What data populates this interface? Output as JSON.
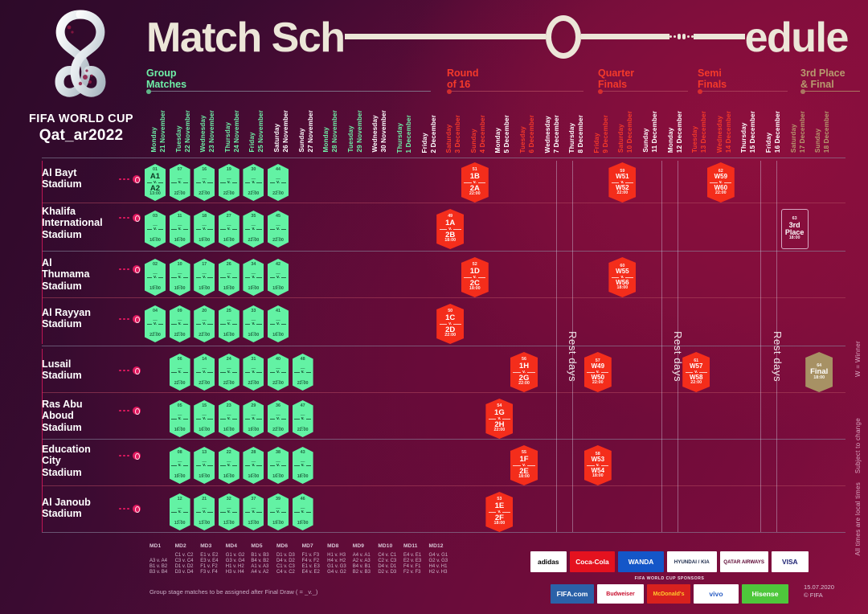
{
  "header": {
    "title_part1": "Match Sch",
    "title_part2": "edule",
    "brand_line1": "FIFA WORLD CUP",
    "brand_line2": "Qat_ar2022",
    "trophy_alt": "qatar-2022-emblem"
  },
  "phases": [
    {
      "label": "Group\nMatches",
      "color": "#6ef0a7"
    },
    {
      "label": "Round\nof 16",
      "color": "#f4392a"
    },
    {
      "label": "Quarter\nFinals",
      "color": "#f4392a"
    },
    {
      "label": "Semi\nFinals",
      "color": "#f4392a"
    },
    {
      "label": "3rd Place\n& Final",
      "color": "#b79a6e"
    }
  ],
  "dates": [
    {
      "day": "Monday",
      "date": "21 November",
      "color": "#6ef0a7"
    },
    {
      "day": "Tuesday",
      "date": "22 November",
      "color": "#6ef0a7"
    },
    {
      "day": "Wednesday",
      "date": "23 November",
      "color": "#6ef0a7"
    },
    {
      "day": "Thursday",
      "date": "24 November",
      "color": "#6ef0a7"
    },
    {
      "day": "Friday",
      "date": "25 November",
      "color": "#6ef0a7"
    },
    {
      "day": "Saturday",
      "date": "26 November",
      "color": "#ffffff"
    },
    {
      "day": "Sunday",
      "date": "27 November",
      "color": "#ffffff"
    },
    {
      "day": "Monday",
      "date": "28 November",
      "color": "#6ef0a7"
    },
    {
      "day": "Tuesday",
      "date": "29 November",
      "color": "#6ef0a7"
    },
    {
      "day": "Wednesday",
      "date": "30 November",
      "color": "#ffffff"
    },
    {
      "day": "Thursday",
      "date": "1 December",
      "color": "#6ef0a7"
    },
    {
      "day": "Friday",
      "date": "2 December",
      "color": "#ffffff"
    },
    {
      "day": "Saturday",
      "date": "3 December",
      "color": "#f4392a"
    },
    {
      "day": "Sunday",
      "date": "4 December",
      "color": "#f4392a"
    },
    {
      "day": "Monday",
      "date": "5 December",
      "color": "#ffffff"
    },
    {
      "day": "Tuesday",
      "date": "6 December",
      "color": "#f4392a"
    },
    {
      "day": "Wednesday",
      "date": "7 December",
      "color": "#ffffff"
    },
    {
      "day": "Thursday",
      "date": "8 December",
      "color": "#ffffff"
    },
    {
      "day": "Friday",
      "date": "9 December",
      "color": "#f4392a"
    },
    {
      "day": "Saturday",
      "date": "10 December",
      "color": "#f4392a"
    },
    {
      "day": "Sunday",
      "date": "11 December",
      "color": "#ffffff"
    },
    {
      "day": "Monday",
      "date": "12 December",
      "color": "#ffffff"
    },
    {
      "day": "Tuesday",
      "date": "13 December",
      "color": "#f4392a"
    },
    {
      "day": "Wednesday",
      "date": "14 December",
      "color": "#f4392a"
    },
    {
      "day": "Thursday",
      "date": "15 December",
      "color": "#ffffff"
    },
    {
      "day": "Friday",
      "date": "16 December",
      "color": "#ffffff"
    },
    {
      "day": "Saturday",
      "date": "17 December",
      "color": "#b79a6e"
    },
    {
      "day": "Sunday",
      "date": "18 December",
      "color": "#b79a6e"
    }
  ],
  "stadiums": [
    "Al Bayt\nStadium",
    "Khalifa\nInternational\nStadium",
    "Al\nThumama\nStadium",
    "Al Rayyan\nStadium",
    "Lusail\nStadium",
    "Ras Abu\nAboud\nStadium",
    "Education\nCity\nStadium",
    "Al Janoub\nStadium"
  ],
  "matches": [
    {
      "no": "01",
      "t1": "A1",
      "t2": "A2",
      "time": "13:00",
      "row": 0,
      "col": 0,
      "kind": "green"
    },
    {
      "no": "07",
      "t1": "_",
      "t2": "_",
      "time": "22:00",
      "row": 0,
      "col": 1,
      "kind": "green"
    },
    {
      "no": "16",
      "t1": "_",
      "t2": "_",
      "time": "22:00",
      "row": 0,
      "col": 2,
      "kind": "green"
    },
    {
      "no": "19",
      "t1": "_",
      "t2": "_",
      "time": "22:00",
      "row": 0,
      "col": 3,
      "kind": "green"
    },
    {
      "no": "30",
      "t1": "_",
      "t2": "_",
      "time": "22:00",
      "row": 0,
      "col": 4,
      "kind": "green"
    },
    {
      "no": "44",
      "t1": "_",
      "t2": "_",
      "time": "22:00",
      "row": 0,
      "col": 5,
      "kind": "green"
    },
    {
      "no": "03",
      "t1": "_",
      "t2": "_",
      "time": "16:00",
      "row": 1,
      "col": 0,
      "kind": "green"
    },
    {
      "no": "11",
      "t1": "_",
      "t2": "_",
      "time": "16:00",
      "row": 1,
      "col": 1,
      "kind": "green"
    },
    {
      "no": "18",
      "t1": "_",
      "t2": "_",
      "time": "19:00",
      "row": 1,
      "col": 2,
      "kind": "green"
    },
    {
      "no": "27",
      "t1": "_",
      "t2": "_",
      "time": "16:00",
      "row": 1,
      "col": 3,
      "kind": "green"
    },
    {
      "no": "35",
      "t1": "_",
      "t2": "_",
      "time": "22:00",
      "row": 1,
      "col": 4,
      "kind": "green"
    },
    {
      "no": "45",
      "t1": "_",
      "t2": "_",
      "time": "22:00",
      "row": 1,
      "col": 5,
      "kind": "green"
    },
    {
      "no": "02",
      "t1": "_",
      "t2": "_",
      "time": "19:00",
      "row": 2,
      "col": 0,
      "kind": "green"
    },
    {
      "no": "10",
      "t1": "_",
      "t2": "_",
      "time": "19:00",
      "row": 2,
      "col": 1,
      "kind": "green"
    },
    {
      "no": "17",
      "t1": "_",
      "t2": "_",
      "time": "19:00",
      "row": 2,
      "col": 2,
      "kind": "green"
    },
    {
      "no": "26",
      "t1": "_",
      "t2": "_",
      "time": "19:00",
      "row": 2,
      "col": 3,
      "kind": "green"
    },
    {
      "no": "34",
      "t1": "_",
      "t2": "_",
      "time": "19:00",
      "row": 2,
      "col": 4,
      "kind": "green"
    },
    {
      "no": "42",
      "t1": "_",
      "t2": "_",
      "time": "19:00",
      "row": 2,
      "col": 5,
      "kind": "green"
    },
    {
      "no": "04",
      "t1": "_",
      "t2": "_",
      "time": "22:00",
      "row": 3,
      "col": 0,
      "kind": "green"
    },
    {
      "no": "09",
      "t1": "_",
      "t2": "_",
      "time": "22:00",
      "row": 3,
      "col": 1,
      "kind": "green"
    },
    {
      "no": "20",
      "t1": "_",
      "t2": "_",
      "time": "22:00",
      "row": 3,
      "col": 2,
      "kind": "green"
    },
    {
      "no": "25",
      "t1": "_",
      "t2": "_",
      "time": "16:00",
      "row": 3,
      "col": 3,
      "kind": "green"
    },
    {
      "no": "33",
      "t1": "_",
      "t2": "_",
      "time": "16:00",
      "row": 3,
      "col": 4,
      "kind": "green"
    },
    {
      "no": "41",
      "t1": "_",
      "t2": "_",
      "time": "16:00",
      "row": 3,
      "col": 5,
      "kind": "green"
    },
    {
      "no": "06",
      "t1": "_",
      "t2": "_",
      "time": "22:00",
      "row": 4,
      "col": 1,
      "kind": "green"
    },
    {
      "no": "14",
      "t1": "_",
      "t2": "_",
      "time": "22:00",
      "row": 4,
      "col": 2,
      "kind": "green"
    },
    {
      "no": "24",
      "t1": "_",
      "t2": "_",
      "time": "22:00",
      "row": 4,
      "col": 3,
      "kind": "green"
    },
    {
      "no": "31",
      "t1": "_",
      "t2": "_",
      "time": "22:00",
      "row": 4,
      "col": 4,
      "kind": "green"
    },
    {
      "no": "40",
      "t1": "_",
      "t2": "_",
      "time": "22:00",
      "row": 4,
      "col": 5,
      "kind": "green"
    },
    {
      "no": "48",
      "t1": "_",
      "t2": "_",
      "time": "22:00",
      "row": 4,
      "col": 6,
      "kind": "green"
    },
    {
      "no": "05",
      "t1": "_",
      "t2": "_",
      "time": "16:00",
      "row": 5,
      "col": 1,
      "kind": "green"
    },
    {
      "no": "15",
      "t1": "_",
      "t2": "_",
      "time": "16:00",
      "row": 5,
      "col": 2,
      "kind": "green"
    },
    {
      "no": "23",
      "t1": "_",
      "t2": "_",
      "time": "16:00",
      "row": 5,
      "col": 3,
      "kind": "green"
    },
    {
      "no": "29",
      "t1": "_",
      "t2": "_",
      "time": "19:00",
      "row": 5,
      "col": 4,
      "kind": "green"
    },
    {
      "no": "36",
      "t1": "_",
      "t2": "_",
      "time": "22:00",
      "row": 5,
      "col": 5,
      "kind": "green"
    },
    {
      "no": "47",
      "t1": "_",
      "t2": "_",
      "time": "22:00",
      "row": 5,
      "col": 6,
      "kind": "green"
    },
    {
      "no": "08",
      "t1": "_",
      "t2": "_",
      "time": "19:00",
      "row": 6,
      "col": 1,
      "kind": "green"
    },
    {
      "no": "13",
      "t1": "_",
      "t2": "_",
      "time": "19:00",
      "row": 6,
      "col": 2,
      "kind": "green"
    },
    {
      "no": "22",
      "t1": "_",
      "t2": "_",
      "time": "16:00",
      "row": 6,
      "col": 3,
      "kind": "green"
    },
    {
      "no": "28",
      "t1": "_",
      "t2": "_",
      "time": "16:00",
      "row": 6,
      "col": 4,
      "kind": "green"
    },
    {
      "no": "38",
      "t1": "_",
      "t2": "_",
      "time": "16:00",
      "row": 6,
      "col": 5,
      "kind": "green"
    },
    {
      "no": "43",
      "t1": "_",
      "t2": "_",
      "time": "18:00",
      "row": 6,
      "col": 6,
      "kind": "green"
    },
    {
      "no": "12",
      "t1": "_",
      "t2": "_",
      "time": "13:00",
      "row": 7,
      "col": 1,
      "kind": "green"
    },
    {
      "no": "21",
      "t1": "_",
      "t2": "_",
      "time": "13:00",
      "row": 7,
      "col": 2,
      "kind": "green"
    },
    {
      "no": "32",
      "t1": "_",
      "t2": "_",
      "time": "13:00",
      "row": 7,
      "col": 3,
      "kind": "green"
    },
    {
      "no": "37",
      "t1": "_",
      "t2": "_",
      "time": "13:00",
      "row": 7,
      "col": 4,
      "kind": "green"
    },
    {
      "no": "39",
      "t1": "_",
      "t2": "_",
      "time": "19:00",
      "row": 7,
      "col": 5,
      "kind": "green"
    },
    {
      "no": "46",
      "t1": "_",
      "t2": "_",
      "time": "19:00",
      "row": 7,
      "col": 6,
      "kind": "green"
    },
    {
      "no": "51",
      "t1": "1B",
      "t2": "2A",
      "time": "22:00",
      "row": 0,
      "col": 13,
      "kind": "red"
    },
    {
      "no": "49",
      "t1": "1A",
      "t2": "2B",
      "time": "18:00",
      "row": 1,
      "col": 12,
      "kind": "red"
    },
    {
      "no": "52",
      "t1": "1D",
      "t2": "2C",
      "time": "18:00",
      "row": 2,
      "col": 13,
      "kind": "red"
    },
    {
      "no": "50",
      "t1": "1C",
      "t2": "2D",
      "time": "22:00",
      "row": 3,
      "col": 12,
      "kind": "red"
    },
    {
      "no": "56",
      "t1": "1H",
      "t2": "2G",
      "time": "22:00",
      "row": 4,
      "col": 15,
      "kind": "red"
    },
    {
      "no": "54",
      "t1": "1G",
      "t2": "2H",
      "time": "22:00",
      "row": 5,
      "col": 14,
      "kind": "red"
    },
    {
      "no": "55",
      "t1": "1F",
      "t2": "2E",
      "time": "18:00",
      "row": 6,
      "col": 15,
      "kind": "red"
    },
    {
      "no": "53",
      "t1": "1E",
      "t2": "2F",
      "time": "18:00",
      "row": 7,
      "col": 14,
      "kind": "red"
    },
    {
      "no": "59",
      "t1": "W51",
      "t2": "W52",
      "time": "22:00",
      "row": 0,
      "col": 19,
      "kind": "red"
    },
    {
      "no": "60",
      "t1": "W55",
      "t2": "W56",
      "time": "18:00",
      "row": 2,
      "col": 19,
      "kind": "red"
    },
    {
      "no": "57",
      "t1": "W49",
      "t2": "W50",
      "time": "22:00",
      "row": 4,
      "col": 18,
      "kind": "red"
    },
    {
      "no": "58",
      "t1": "W53",
      "t2": "W54",
      "time": "18:00",
      "row": 6,
      "col": 18,
      "kind": "red"
    },
    {
      "no": "62",
      "t1": "W59",
      "t2": "W60",
      "time": "22:00",
      "row": 0,
      "col": 23,
      "kind": "red"
    },
    {
      "no": "61",
      "t1": "W57",
      "t2": "W58",
      "time": "22:00",
      "row": 4,
      "col": 22,
      "kind": "red"
    },
    {
      "no": "63",
      "t1": "3rd",
      "t2": "Place",
      "time": "18:00",
      "row": 1,
      "col": 26,
      "kind": "outline"
    },
    {
      "no": "64",
      "t1": "Final",
      "t2": "",
      "time": "18:00",
      "row": 4,
      "col": 27,
      "kind": "gold"
    }
  ],
  "rest_days_label": "Rest days",
  "edge_notes": [
    "W = Winner",
    "Subject to change",
    "All times are local times"
  ],
  "legend": {
    "headers": [
      "MD1",
      "MD2",
      "MD3",
      "MD4",
      "MD5",
      "MD6",
      "MD7",
      "MD8",
      "MD9",
      "MD10",
      "MD11",
      "MD12"
    ],
    "rows": [
      [
        "",
        "C1 v. C2",
        "E1 v. E2",
        "G1 v. G2",
        "B1 v. B3",
        "D1 v. D3",
        "F1 v. F3",
        "H1 v. H3",
        "A4 v. A1",
        "C4 v. C1",
        "E4 v. E1",
        "G4 v. G1"
      ],
      [
        "A3 v. A4",
        "C3 v. C4",
        "E3 v. E4",
        "G3 v. G4",
        "B4 v. B2",
        "D4 v. D2",
        "F4 v. F2",
        "H4 v. H2",
        "A2 v. A3",
        "C2 v. C3",
        "E2 v. E3",
        "G2 v. G3"
      ],
      [
        "B1 v. B2",
        "D1 v. D2",
        "F1 v. F2",
        "H1 v. H2",
        "A1 v. A3",
        "C1 v. C3",
        "E1 v. E3",
        "G1 v. G3",
        "B4 v. B1",
        "D4 v. D1",
        "F4 v. F1",
        "H4 v. H1"
      ],
      [
        "B3 v. B4",
        "D3 v. D4",
        "F3 v. F4",
        "H3 v. H4",
        "A4 v. A2",
        "C4 v. C2",
        "E4 v. E2",
        "G4 v. G2",
        "B2 v. B3",
        "D2 v. D3",
        "F2 v. F3",
        "H2 v. H3"
      ]
    ],
    "note": "Group stage matches to be assigned after Final Draw ( = _v._)"
  },
  "sponsors": {
    "tier1": [
      {
        "name": "adidas",
        "bg": "#ffffff",
        "fg": "#000000"
      },
      {
        "name": "Coca-Cola",
        "bg": "#e4121f",
        "fg": "#ffffff"
      },
      {
        "name": "WANDA",
        "bg": "#1456c8",
        "fg": "#ffffff"
      },
      {
        "name": "HYUNDAI / KIA",
        "bg": "#ffffff",
        "fg": "#1b2a4a"
      },
      {
        "name": "QATAR AIRWAYS",
        "bg": "#ffffff",
        "fg": "#5c0632"
      },
      {
        "name": "VISA",
        "bg": "#ffffff",
        "fg": "#1a1f71"
      }
    ],
    "tier2_title": "FIFA WORLD CUP SPONSORS",
    "tier2": [
      {
        "name": "FIFA.com",
        "bg": "#2b61a8",
        "fg": "#ffffff"
      },
      {
        "name": "Budweiser",
        "bg": "#ffffff",
        "fg": "#c8102e"
      },
      {
        "name": "McDonald's",
        "bg": "#d8211e",
        "fg": "#ffc72c"
      },
      {
        "name": "vivo",
        "bg": "#ffffff",
        "fg": "#2b5ec4"
      },
      {
        "name": "Hisense",
        "bg": "#4ec73b",
        "fg": "#ffffff"
      }
    ]
  },
  "footer": {
    "date": "15.07.2020",
    "copyright": "© FIFA"
  },
  "colors": {
    "green": "#63f2a4",
    "red": "#f42d1b",
    "gold": "#a79164",
    "pink": "#e0195f",
    "cream": "#ece6d8"
  }
}
